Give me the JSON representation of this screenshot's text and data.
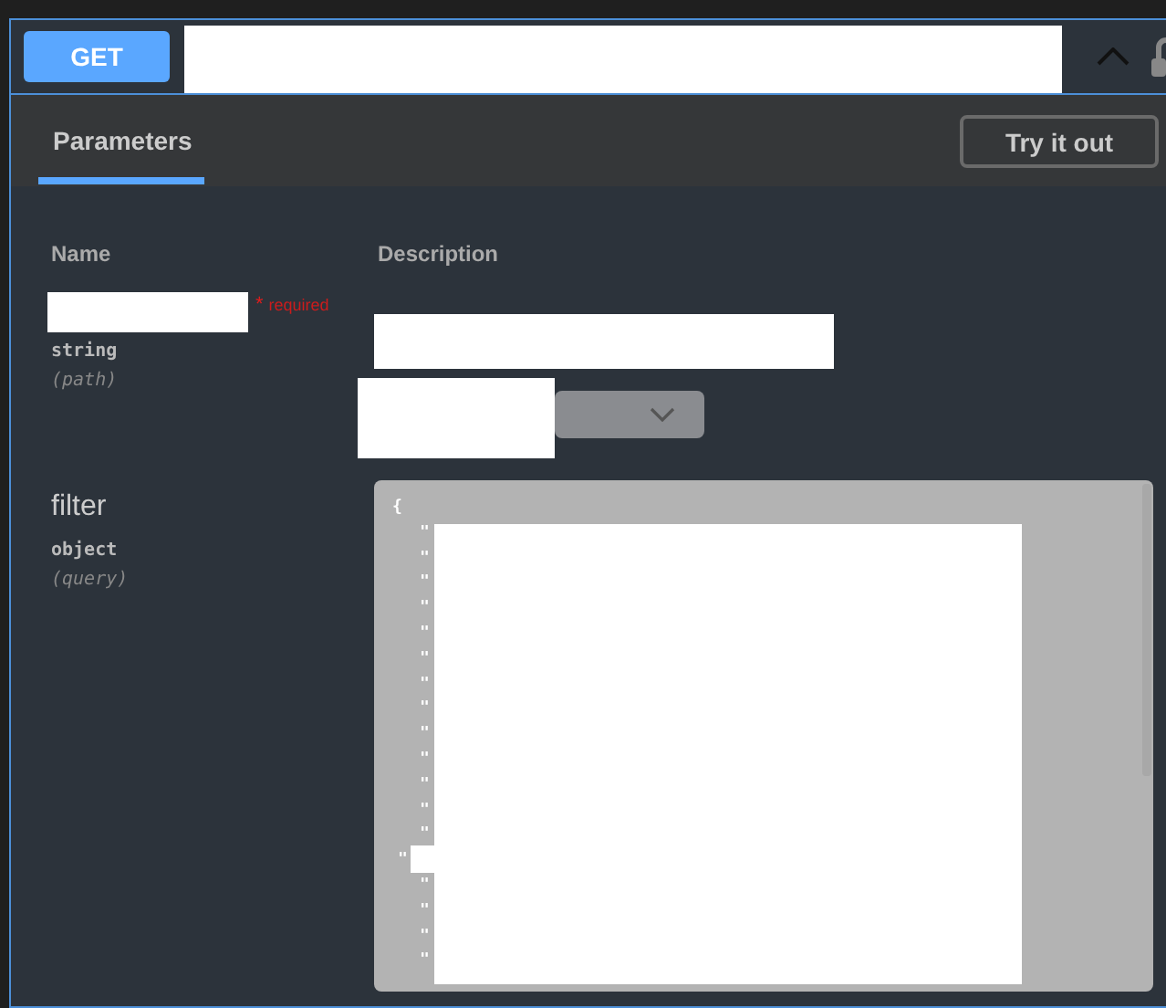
{
  "operation": {
    "method": "GET"
  },
  "tabs": [
    {
      "label": "Parameters",
      "selected": true
    }
  ],
  "try_button": "Try it out",
  "columns": [
    "Name",
    "Description"
  ],
  "parameters": [
    {
      "required_mark": "*",
      "required_label": "required",
      "type": "string",
      "location": "(path)",
      "kind": "select"
    },
    {
      "name": "filter",
      "type": "object",
      "location": "(query)",
      "kind": "code",
      "code_lines": [
        "{",
        "\"",
        "\"",
        "\"",
        "\"",
        "\"",
        "\"",
        "\"",
        "\"",
        "\"",
        "\"",
        "\"",
        "\"",
        "\"",
        "\"",
        "\"",
        "\"",
        "\"",
        "\""
      ]
    }
  ]
}
